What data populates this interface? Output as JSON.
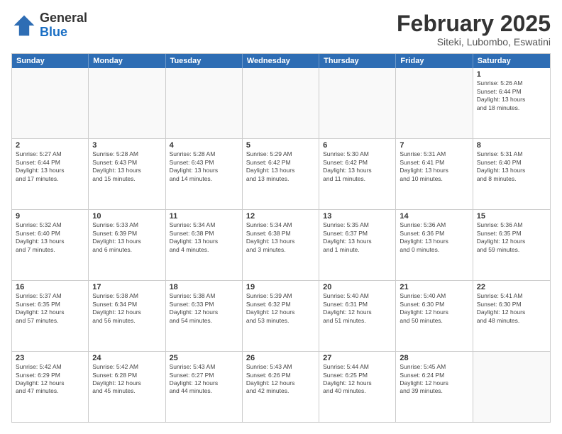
{
  "logo": {
    "general": "General",
    "blue": "Blue"
  },
  "title": "February 2025",
  "location": "Siteki, Lubombo, Eswatini",
  "header_days": [
    "Sunday",
    "Monday",
    "Tuesday",
    "Wednesday",
    "Thursday",
    "Friday",
    "Saturday"
  ],
  "rows": [
    [
      {
        "day": "",
        "info": ""
      },
      {
        "day": "",
        "info": ""
      },
      {
        "day": "",
        "info": ""
      },
      {
        "day": "",
        "info": ""
      },
      {
        "day": "",
        "info": ""
      },
      {
        "day": "",
        "info": ""
      },
      {
        "day": "1",
        "info": "Sunrise: 5:26 AM\nSunset: 6:44 PM\nDaylight: 13 hours\nand 18 minutes."
      }
    ],
    [
      {
        "day": "2",
        "info": "Sunrise: 5:27 AM\nSunset: 6:44 PM\nDaylight: 13 hours\nand 17 minutes."
      },
      {
        "day": "3",
        "info": "Sunrise: 5:28 AM\nSunset: 6:43 PM\nDaylight: 13 hours\nand 15 minutes."
      },
      {
        "day": "4",
        "info": "Sunrise: 5:28 AM\nSunset: 6:43 PM\nDaylight: 13 hours\nand 14 minutes."
      },
      {
        "day": "5",
        "info": "Sunrise: 5:29 AM\nSunset: 6:42 PM\nDaylight: 13 hours\nand 13 minutes."
      },
      {
        "day": "6",
        "info": "Sunrise: 5:30 AM\nSunset: 6:42 PM\nDaylight: 13 hours\nand 11 minutes."
      },
      {
        "day": "7",
        "info": "Sunrise: 5:31 AM\nSunset: 6:41 PM\nDaylight: 13 hours\nand 10 minutes."
      },
      {
        "day": "8",
        "info": "Sunrise: 5:31 AM\nSunset: 6:40 PM\nDaylight: 13 hours\nand 8 minutes."
      }
    ],
    [
      {
        "day": "9",
        "info": "Sunrise: 5:32 AM\nSunset: 6:40 PM\nDaylight: 13 hours\nand 7 minutes."
      },
      {
        "day": "10",
        "info": "Sunrise: 5:33 AM\nSunset: 6:39 PM\nDaylight: 13 hours\nand 6 minutes."
      },
      {
        "day": "11",
        "info": "Sunrise: 5:34 AM\nSunset: 6:38 PM\nDaylight: 13 hours\nand 4 minutes."
      },
      {
        "day": "12",
        "info": "Sunrise: 5:34 AM\nSunset: 6:38 PM\nDaylight: 13 hours\nand 3 minutes."
      },
      {
        "day": "13",
        "info": "Sunrise: 5:35 AM\nSunset: 6:37 PM\nDaylight: 13 hours\nand 1 minute."
      },
      {
        "day": "14",
        "info": "Sunrise: 5:36 AM\nSunset: 6:36 PM\nDaylight: 13 hours\nand 0 minutes."
      },
      {
        "day": "15",
        "info": "Sunrise: 5:36 AM\nSunset: 6:35 PM\nDaylight: 12 hours\nand 59 minutes."
      }
    ],
    [
      {
        "day": "16",
        "info": "Sunrise: 5:37 AM\nSunset: 6:35 PM\nDaylight: 12 hours\nand 57 minutes."
      },
      {
        "day": "17",
        "info": "Sunrise: 5:38 AM\nSunset: 6:34 PM\nDaylight: 12 hours\nand 56 minutes."
      },
      {
        "day": "18",
        "info": "Sunrise: 5:38 AM\nSunset: 6:33 PM\nDaylight: 12 hours\nand 54 minutes."
      },
      {
        "day": "19",
        "info": "Sunrise: 5:39 AM\nSunset: 6:32 PM\nDaylight: 12 hours\nand 53 minutes."
      },
      {
        "day": "20",
        "info": "Sunrise: 5:40 AM\nSunset: 6:31 PM\nDaylight: 12 hours\nand 51 minutes."
      },
      {
        "day": "21",
        "info": "Sunrise: 5:40 AM\nSunset: 6:30 PM\nDaylight: 12 hours\nand 50 minutes."
      },
      {
        "day": "22",
        "info": "Sunrise: 5:41 AM\nSunset: 6:30 PM\nDaylight: 12 hours\nand 48 minutes."
      }
    ],
    [
      {
        "day": "23",
        "info": "Sunrise: 5:42 AM\nSunset: 6:29 PM\nDaylight: 12 hours\nand 47 minutes."
      },
      {
        "day": "24",
        "info": "Sunrise: 5:42 AM\nSunset: 6:28 PM\nDaylight: 12 hours\nand 45 minutes."
      },
      {
        "day": "25",
        "info": "Sunrise: 5:43 AM\nSunset: 6:27 PM\nDaylight: 12 hours\nand 44 minutes."
      },
      {
        "day": "26",
        "info": "Sunrise: 5:43 AM\nSunset: 6:26 PM\nDaylight: 12 hours\nand 42 minutes."
      },
      {
        "day": "27",
        "info": "Sunrise: 5:44 AM\nSunset: 6:25 PM\nDaylight: 12 hours\nand 40 minutes."
      },
      {
        "day": "28",
        "info": "Sunrise: 5:45 AM\nSunset: 6:24 PM\nDaylight: 12 hours\nand 39 minutes."
      },
      {
        "day": "",
        "info": ""
      }
    ]
  ]
}
